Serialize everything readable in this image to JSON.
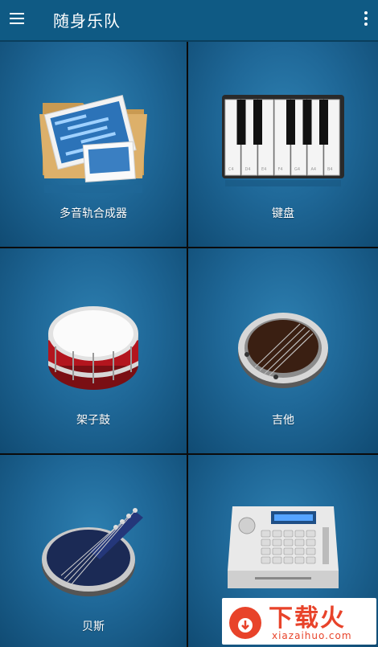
{
  "app": {
    "title": "随身乐队"
  },
  "icons": {
    "menu": "menu-icon",
    "more": "more-vert-icon"
  },
  "tiles": [
    {
      "label": "多音轨合成器",
      "icon": "multitrack-folder-icon"
    },
    {
      "label": "键盘",
      "icon": "piano-keyboard-icon"
    },
    {
      "label": "架子鼓",
      "icon": "drum-icon"
    },
    {
      "label": "吉他",
      "icon": "guitar-icon"
    },
    {
      "label": "贝斯",
      "icon": "bass-guitar-icon"
    },
    {
      "label": "",
      "icon": "drum-machine-icon"
    }
  ],
  "piano_key_labels": [
    "C4",
    "D4",
    "E4",
    "F4",
    "G4",
    "A4",
    "B4"
  ],
  "watermark": {
    "name": "下载火",
    "url": "xiazaihuo.com"
  },
  "colors": {
    "appbar": "#0f5a84",
    "tile": "#1f6898",
    "divider": "#0b0b0b",
    "watermark": "#e8432a"
  }
}
